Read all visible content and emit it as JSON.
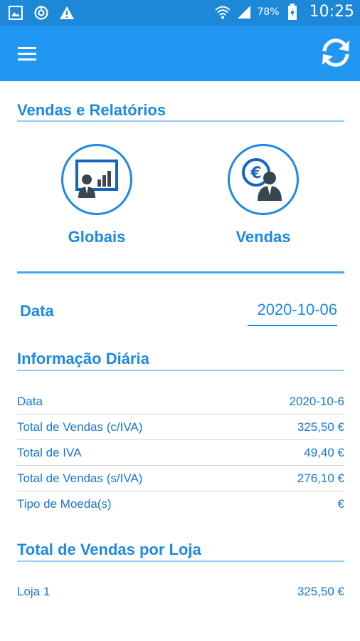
{
  "status_bar": {
    "battery_pct": "78%",
    "time": "10:25"
  },
  "app_bar": {
    "menu_icon": "menu-icon",
    "refresh_icon": "refresh-icon"
  },
  "reports": {
    "title": "Vendas e Relatórios",
    "tiles": [
      {
        "label": "Globais",
        "icon": "presentation-chart-icon"
      },
      {
        "label": "Vendas",
        "icon": "euro-person-icon"
      }
    ]
  },
  "date_filter": {
    "label": "Data",
    "value": "2020-10-06"
  },
  "daily_info": {
    "title": "Informação Diária",
    "rows": [
      {
        "label": "Data",
        "value": "2020-10-6"
      },
      {
        "label": "Total de Vendas (c/IVA)",
        "value": "325,50 €"
      },
      {
        "label": "Total de IVA",
        "value": "49,40 €"
      },
      {
        "label": "Total de Vendas (s/IVA)",
        "value": "276,10 €"
      },
      {
        "label": "Tipo de Moeda(s)",
        "value": "€"
      }
    ]
  },
  "store_totals": {
    "title": "Total de Vendas por Loja",
    "rows": [
      {
        "label": "Loja 1",
        "value": "325,50 €"
      }
    ]
  },
  "colors": {
    "status_bar": "#1e88d8",
    "app_bar": "#2196f3",
    "accent": "#1e88e5"
  }
}
